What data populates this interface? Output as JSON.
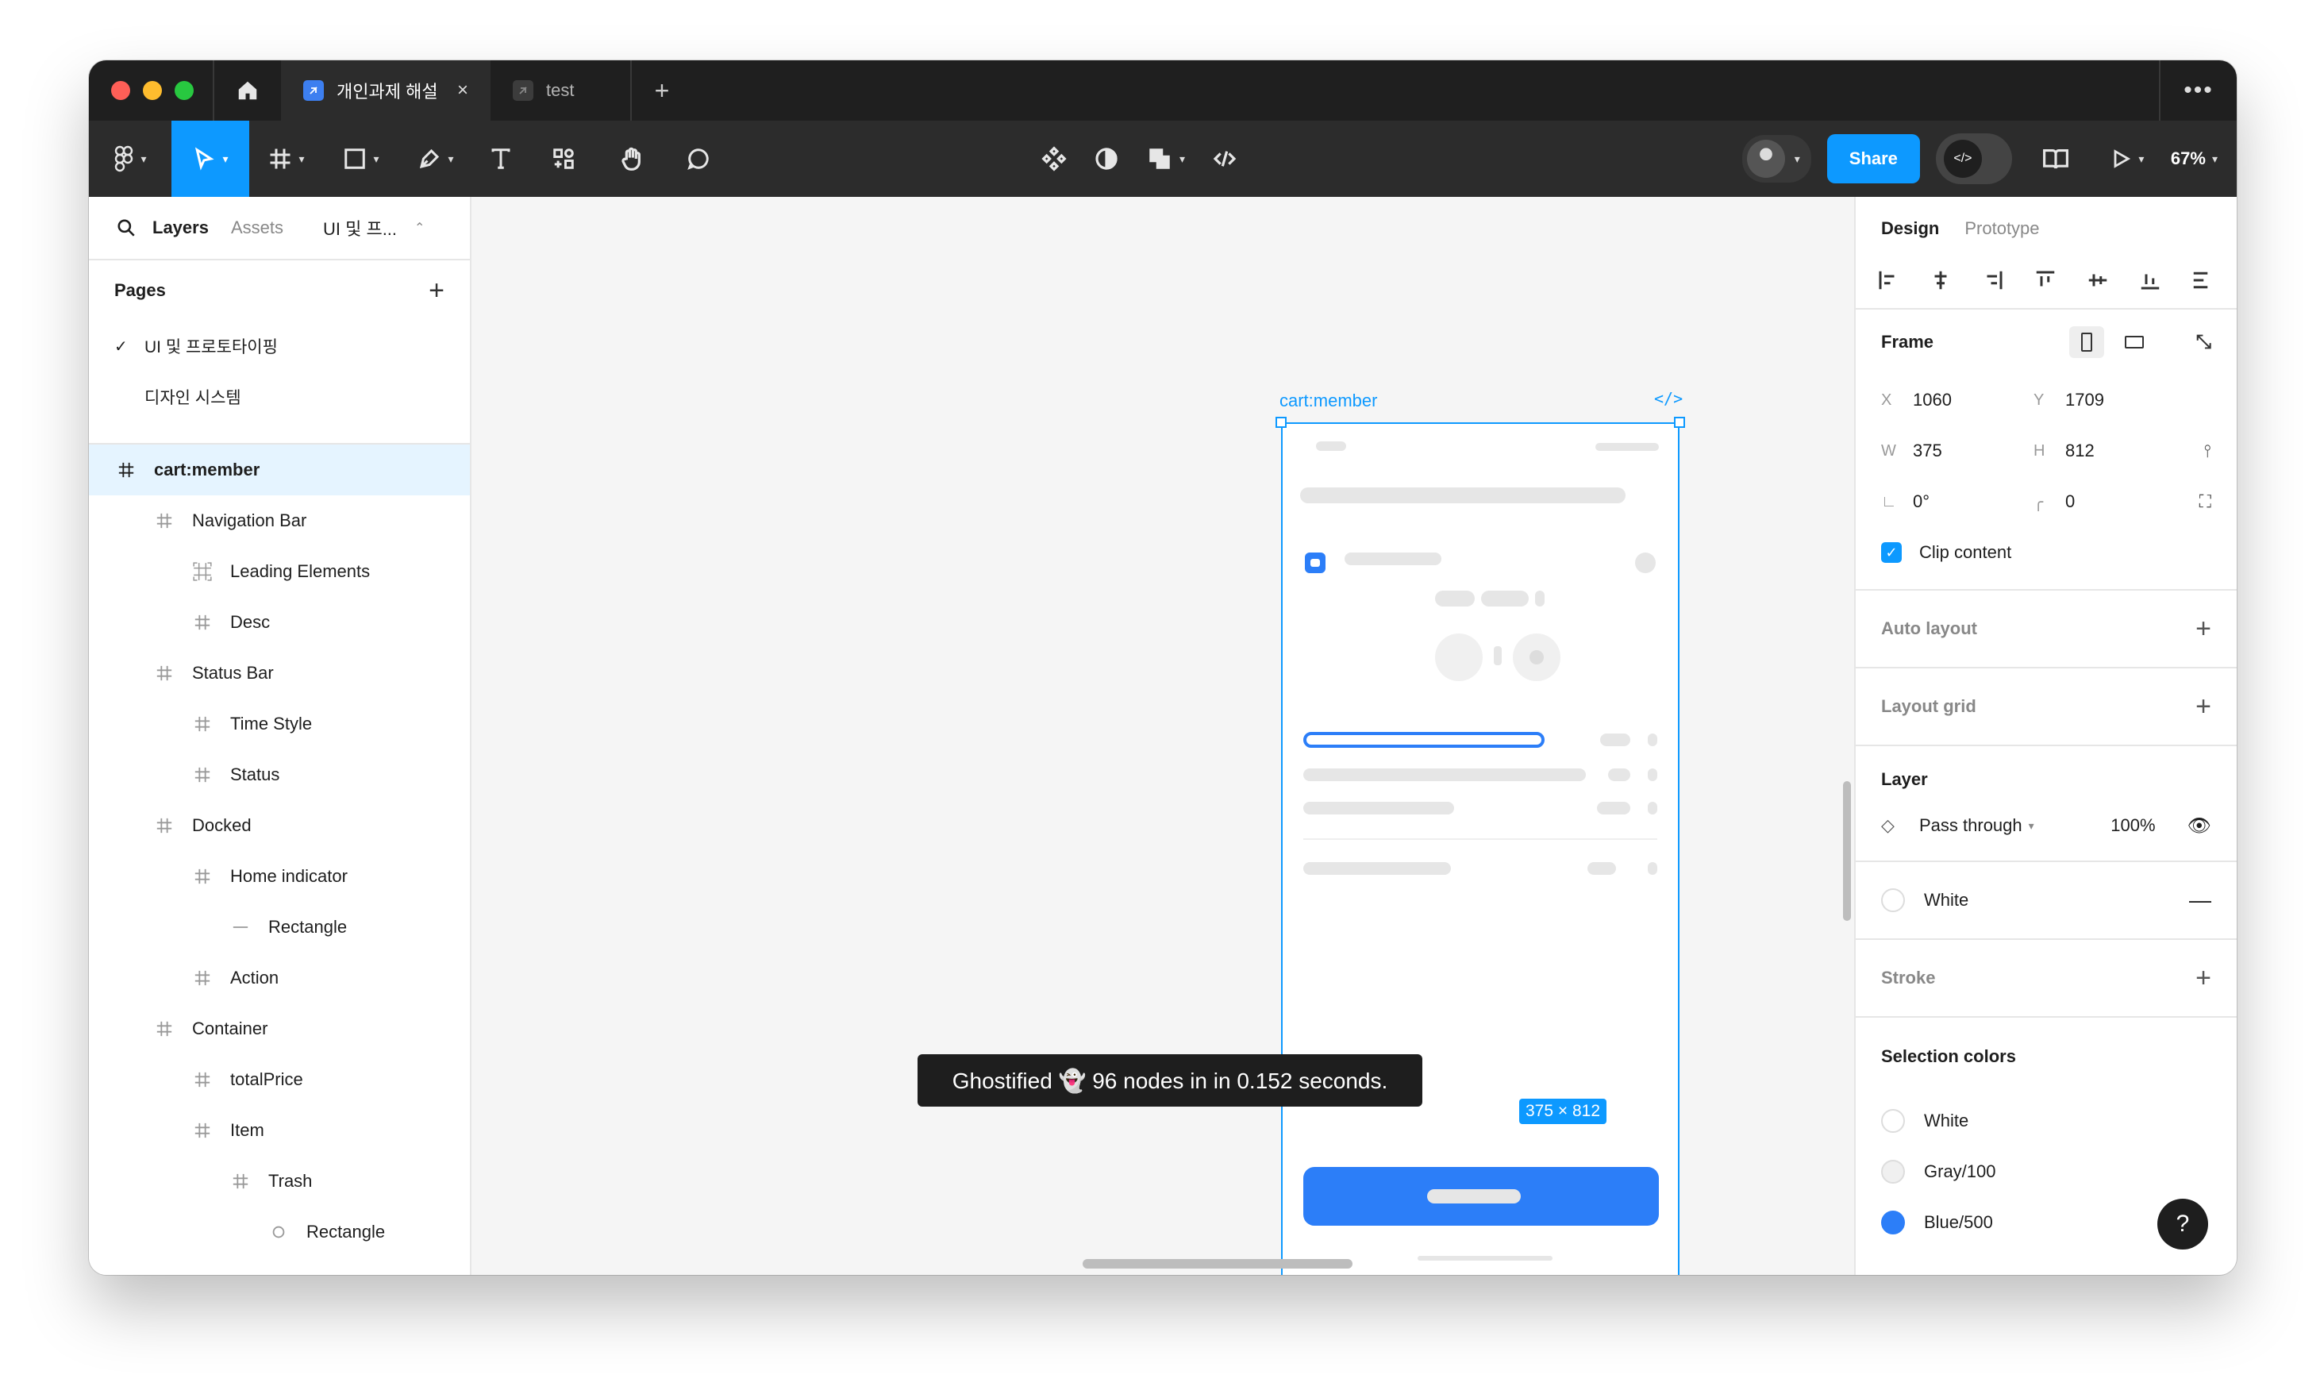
{
  "tabs": [
    {
      "label": "개인과제 해설",
      "active": true
    },
    {
      "label": "test",
      "active": false
    }
  ],
  "toolbar": {
    "share_label": "Share",
    "zoom": "67%"
  },
  "left_panel": {
    "tabs": [
      "Layers",
      "Assets",
      "UI 및 프..."
    ],
    "pages_title": "Pages",
    "pages": [
      {
        "label": "UI 및 프로토타이핑",
        "checked": true
      },
      {
        "label": "디자인 시스템",
        "checked": false
      }
    ],
    "layers": [
      {
        "label": "cart:member",
        "indent": 0,
        "icon": "frame-icon",
        "selected": true
      },
      {
        "label": "Navigation Bar",
        "indent": 1,
        "icon": "frame-icon"
      },
      {
        "label": "Leading Elements",
        "indent": 2,
        "icon": "auto-layout-icon"
      },
      {
        "label": "Desc",
        "indent": 2,
        "icon": "frame-icon"
      },
      {
        "label": "Status Bar",
        "indent": 1,
        "icon": "frame-icon"
      },
      {
        "label": "Time Style",
        "indent": 2,
        "icon": "frame-icon"
      },
      {
        "label": "Status",
        "indent": 2,
        "icon": "frame-icon"
      },
      {
        "label": "Docked",
        "indent": 1,
        "icon": "frame-icon"
      },
      {
        "label": "Home indicator",
        "indent": 2,
        "icon": "frame-icon"
      },
      {
        "label": "Rectangle",
        "indent": 3,
        "icon": "line-icon"
      },
      {
        "label": "Action",
        "indent": 2,
        "icon": "frame-icon"
      },
      {
        "label": "Container",
        "indent": 1,
        "icon": "frame-icon"
      },
      {
        "label": "totalPrice",
        "indent": 2,
        "icon": "frame-icon"
      },
      {
        "label": "Item",
        "indent": 2,
        "icon": "frame-icon"
      },
      {
        "label": "Trash",
        "indent": 3,
        "icon": "frame-icon"
      },
      {
        "label": "Rectangle",
        "indent": 4,
        "icon": "ellipse-icon"
      }
    ]
  },
  "canvas": {
    "frame_name": "cart:member",
    "code_badge": "</>",
    "dimensions": "375 × 812",
    "toast": "Ghostified 👻 96 nodes in in 0.152 seconds."
  },
  "right_panel": {
    "tabs": [
      "Design",
      "Prototype"
    ],
    "frame": {
      "title": "Frame",
      "x_label": "X",
      "x": "1060",
      "y_label": "Y",
      "y": "1709",
      "w_label": "W",
      "w": "375",
      "h_label": "H",
      "h": "812",
      "rotation": "0°",
      "radius": "0",
      "clip_content": "Clip content"
    },
    "auto_layout": "Auto layout",
    "layout_grid": "Layout grid",
    "layer": {
      "title": "Layer",
      "blend": "Pass through",
      "opacity": "100%"
    },
    "fill": {
      "label": "White"
    },
    "stroke": "Stroke",
    "selection_colors": {
      "title": "Selection colors",
      "items": [
        {
          "label": "White",
          "color": "#ffffff"
        },
        {
          "label": "Gray/100",
          "color": "#f0f0f0"
        },
        {
          "label": "Blue/500",
          "color": "#2c7ef8"
        }
      ]
    },
    "help": "?"
  }
}
